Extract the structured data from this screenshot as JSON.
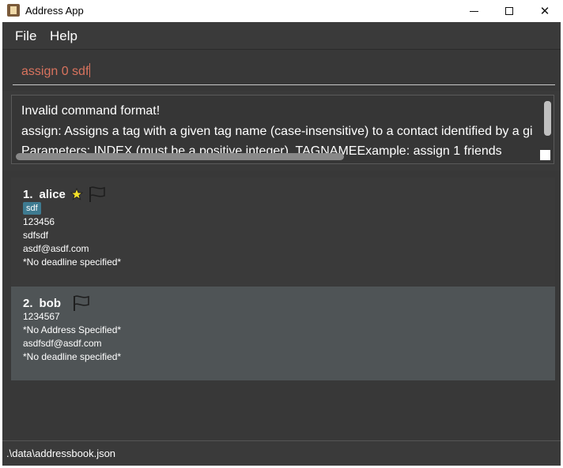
{
  "window": {
    "title": "Address App",
    "controls": {
      "minimize": "—",
      "maximize": "☐",
      "close": "✕"
    }
  },
  "menu": {
    "file": "File",
    "help": "Help"
  },
  "command": {
    "value": "assign 0 sdf",
    "text_color": "#d8735e"
  },
  "result": {
    "line1": "Invalid command format!",
    "line2": "assign: Assigns a tag with a given tag name (case-insensitive) to a contact identified by a gi",
    "line3": "Parameters: INDEX (must be a positive integer), TAGNAMEExample: assign 1 friends"
  },
  "persons": [
    {
      "index": "1.",
      "name": "alice",
      "starred": true,
      "tag": "sdf",
      "phone": "123456",
      "address": "sdfsdf",
      "email": "asdf@asdf.com",
      "deadline": "*No deadline specified*"
    },
    {
      "index": "2.",
      "name": "bob",
      "starred": false,
      "phone": "1234567",
      "address": "*No Address Specified*",
      "email": "asdfsdf@asdf.com",
      "deadline": "*No deadline specified*"
    }
  ],
  "status": {
    "path": ".\\data\\addressbook.json"
  },
  "colors": {
    "background": "#3a3a3a",
    "selected_card": "#4f5456",
    "tag": "#3e7b91",
    "star": "#f5e12a"
  }
}
